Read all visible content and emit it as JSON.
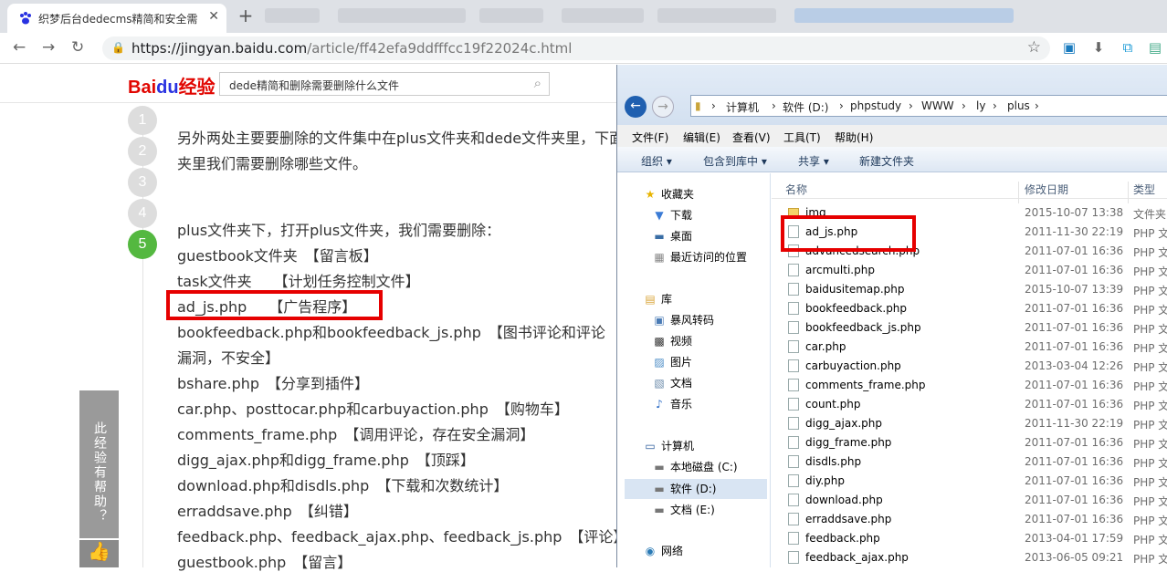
{
  "browser": {
    "tab_title": "织梦后台dedecms精简和安全需",
    "url_host": "https://jingyan.baidu.com",
    "url_path": "/article/ff42efa9ddfffcc19f22024c.html"
  },
  "baidu": {
    "logo_bai": "Bai",
    "logo_du": "du",
    "logo_jingyan": "经验",
    "search_value": "dede精简和删除需要删除什么文件"
  },
  "article": {
    "steps": [
      "1",
      "2",
      "3",
      "4",
      "5"
    ],
    "intro_line1": "另外两处主要要删除的文件集中在plus文件夹和dede文件夹里，下面",
    "intro_line2": "夹里我们需要删除哪些文件。",
    "lines": [
      "plus文件夹下，打开plus文件夹，我们需要删除：",
      "guestbook文件夹　【留言板】",
      "task文件夹　　【计划任务控制文件】",
      "ad_js.php　　【广告程序】",
      "bookfeedback.php和bookfeedback_js.php　【图书评论和评论",
      "漏洞，不安全】",
      "bshare.php　【分享到插件】",
      "car.php、posttocar.php和carbuyaction.php　【购物车】",
      "comments_frame.php　【调用评论，存在安全漏洞】",
      "digg_ajax.php和digg_frame.php　【顶踩】",
      "download.php和disdls.php　【下载和次数统计】",
      "erraddsave.php　【纠错】",
      "feedback.php、feedback_ajax.php、feedback_js.php　【评论】",
      "guestbook.php　【留言】"
    ],
    "side_vote": "此经验有帮助？"
  },
  "explorer": {
    "breadcrumb": [
      "计算机",
      "软件 (D:)",
      "phpstudy",
      "WWW",
      "ly",
      "plus"
    ],
    "menu": [
      "文件(F)",
      "编辑(E)",
      "查看(V)",
      "工具(T)",
      "帮助(H)"
    ],
    "toolbar": [
      "组织 ▾",
      "包含到库中 ▾",
      "共享 ▾",
      "新建文件夹"
    ],
    "nav": {
      "favorites": "收藏夹",
      "downloads": "下载",
      "desktop": "桌面",
      "recent": "最近访问的位置",
      "library": "库",
      "storm": "暴风转码",
      "video": "视频",
      "pictures": "图片",
      "docs": "文档",
      "music": "音乐",
      "computer": "计算机",
      "drive_c": "本地磁盘 (C:)",
      "drive_d": "软件 (D:)",
      "drive_e": "文档 (E:)",
      "network": "网络"
    },
    "columns": {
      "name": "名称",
      "date": "修改日期",
      "type": "类型"
    },
    "files": [
      {
        "name": "img",
        "date": "2015-10-07 13:38",
        "type": "文件夹",
        "folder": true
      },
      {
        "name": "ad_js.php",
        "date": "2011-11-30 22:19",
        "type": "PHP 文"
      },
      {
        "name": "advancedsearch.php",
        "date": "2011-07-01 16:36",
        "type": "PHP 文"
      },
      {
        "name": "arcmulti.php",
        "date": "2011-07-01 16:36",
        "type": "PHP 文"
      },
      {
        "name": "baidusitemap.php",
        "date": "2015-10-07 13:39",
        "type": "PHP 文"
      },
      {
        "name": "bookfeedback.php",
        "date": "2011-07-01 16:36",
        "type": "PHP 文"
      },
      {
        "name": "bookfeedback_js.php",
        "date": "2011-07-01 16:36",
        "type": "PHP 文"
      },
      {
        "name": "car.php",
        "date": "2011-07-01 16:36",
        "type": "PHP 文"
      },
      {
        "name": "carbuyaction.php",
        "date": "2013-03-04 12:26",
        "type": "PHP 文"
      },
      {
        "name": "comments_frame.php",
        "date": "2011-07-01 16:36",
        "type": "PHP 文"
      },
      {
        "name": "count.php",
        "date": "2011-07-01 16:36",
        "type": "PHP 文"
      },
      {
        "name": "digg_ajax.php",
        "date": "2011-11-30 22:19",
        "type": "PHP 文"
      },
      {
        "name": "digg_frame.php",
        "date": "2011-07-01 16:36",
        "type": "PHP 文"
      },
      {
        "name": "disdls.php",
        "date": "2011-07-01 16:36",
        "type": "PHP 文"
      },
      {
        "name": "diy.php",
        "date": "2011-07-01 16:36",
        "type": "PHP 文"
      },
      {
        "name": "download.php",
        "date": "2011-07-01 16:36",
        "type": "PHP 文"
      },
      {
        "name": "erraddsave.php",
        "date": "2011-07-01 16:36",
        "type": "PHP 文"
      },
      {
        "name": "feedback.php",
        "date": "2013-04-01 17:59",
        "type": "PHP 文"
      },
      {
        "name": "feedback_ajax.php",
        "date": "2013-06-05 09:21",
        "type": "PHP 文"
      }
    ]
  }
}
